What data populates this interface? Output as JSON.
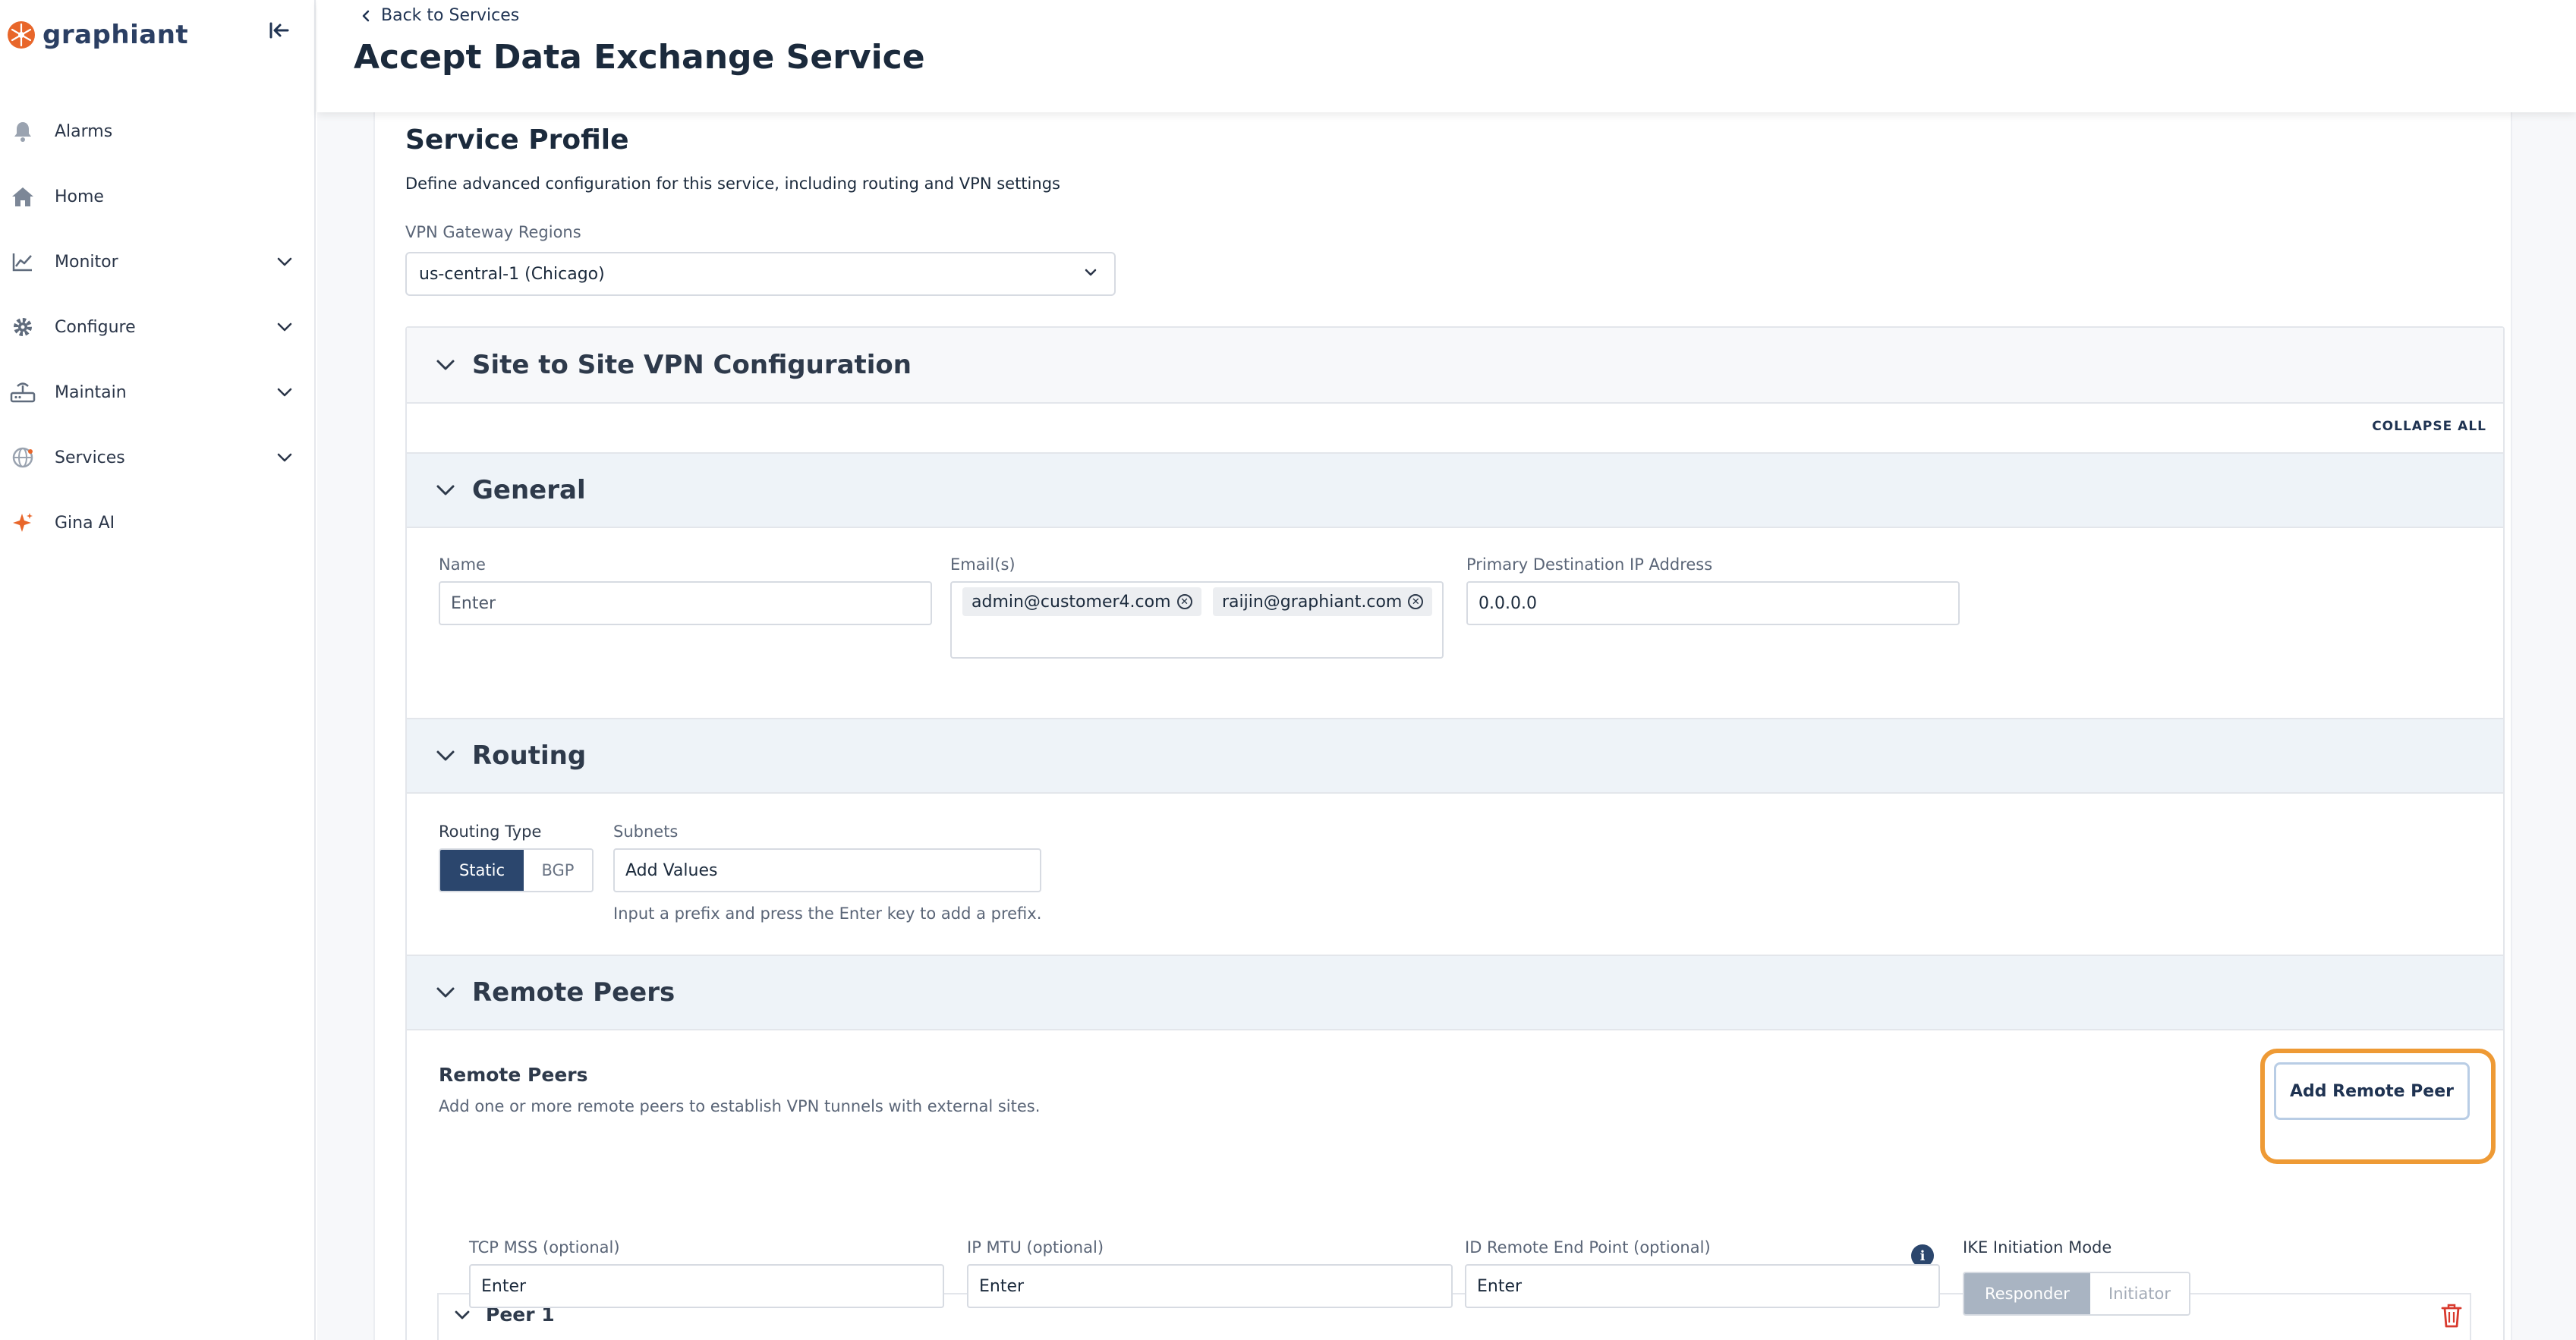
{
  "app": {
    "logo_text": "graphiant",
    "collapse_icon": "collapse-sidebar-icon"
  },
  "sidebar": {
    "items": [
      {
        "label": "Alarms",
        "icon": "bell-icon"
      },
      {
        "label": "Home",
        "icon": "home-icon"
      },
      {
        "label": "Monitor",
        "icon": "chart-line-icon",
        "expandable": true
      },
      {
        "label": "Configure",
        "icon": "gear-icon",
        "expandable": true
      },
      {
        "label": "Maintain",
        "icon": "router-icon",
        "expandable": true
      },
      {
        "label": "Services",
        "icon": "globe-network-icon",
        "expandable": true
      },
      {
        "label": "Gina AI",
        "icon": "sparkle-icon"
      }
    ]
  },
  "header": {
    "back_label": "Back to Services",
    "title": "Accept Data Exchange Service"
  },
  "service_profile": {
    "title": "Service Profile",
    "description": "Define advanced configuration for this service, including routing and VPN settings",
    "vpn_region_label": "VPN Gateway Regions",
    "vpn_region_value": "us-central-1 (Chicago)"
  },
  "site_to_site": {
    "title": "Site to Site VPN Configuration",
    "collapse_all": "COLLAPSE ALL"
  },
  "general": {
    "title": "General",
    "name_label": "Name",
    "name_placeholder": "Enter",
    "emails_label": "Email(s)",
    "emails": [
      "admin@customer4.com",
      "raijin@graphiant.com"
    ],
    "primary_ip_label": "Primary Destination IP Address",
    "primary_ip_value": "0.0.0.0"
  },
  "routing": {
    "title": "Routing",
    "routing_type_label": "Routing Type",
    "options": [
      "Static",
      "BGP"
    ],
    "selected": "Static",
    "subnets_label": "Subnets",
    "subnets_placeholder": "Add Values",
    "subnets_helper": "Input a prefix and press the Enter key to add a prefix."
  },
  "remote_peers": {
    "title": "Remote Peers",
    "subtitle": "Remote Peers",
    "description": "Add one or more remote peers to establish VPN tunnels with external sites.",
    "add_button": "Add Remote Peer",
    "peer": {
      "title": "Peer 1",
      "tcp_mss_label": "TCP MSS (optional)",
      "tcp_mss_placeholder": "Enter",
      "ip_mtu_label": "IP MTU (optional)",
      "ip_mtu_placeholder": "Enter",
      "id_remote_label": "ID Remote End Point (optional)",
      "id_remote_placeholder": "Enter",
      "ike_label": "IKE Initiation Mode",
      "ike_options": [
        "Responder",
        "Initiator"
      ],
      "ike_selected": "Responder"
    }
  },
  "colors": {
    "accent": "#2b466d",
    "highlight": "#ee9a35",
    "logo_orange": "#e8662a",
    "danger": "#d83a2e"
  }
}
